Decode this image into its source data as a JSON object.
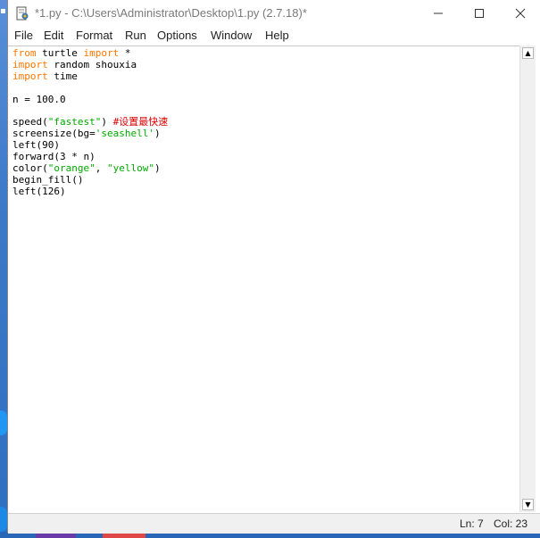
{
  "window": {
    "title": "*1.py - C:\\Users\\Administrator\\Desktop\\1.py (2.7.18)*"
  },
  "menu": [
    "File",
    "Edit",
    "Format",
    "Run",
    "Options",
    "Window",
    "Help"
  ],
  "editor": {
    "lines": [
      [
        {
          "t": "from",
          "c": "kw"
        },
        {
          "t": " turtle "
        },
        {
          "t": "import",
          "c": "kw"
        },
        {
          "t": " *"
        }
      ],
      [
        {
          "t": "import",
          "c": "kw"
        },
        {
          "t": " random shouxia"
        }
      ],
      [
        {
          "t": "import",
          "c": "kw"
        },
        {
          "t": " time"
        }
      ],
      [],
      [
        {
          "t": "n = 100.0"
        }
      ],
      [],
      [
        {
          "t": "speed("
        },
        {
          "t": "\"fastest\"",
          "c": "str"
        },
        {
          "t": ") "
        },
        {
          "t": "#设置最快速",
          "c": "cm"
        }
      ],
      [
        {
          "t": "screensize(bg="
        },
        {
          "t": "'seashell'",
          "c": "str"
        },
        {
          "t": ")"
        }
      ],
      [
        {
          "t": "left(90)"
        }
      ],
      [
        {
          "t": "forward(3 * n)"
        }
      ],
      [
        {
          "t": "color("
        },
        {
          "t": "\"orange\"",
          "c": "str"
        },
        {
          "t": ", "
        },
        {
          "t": "\"yellow\"",
          "c": "str"
        },
        {
          "t": ")"
        }
      ],
      [
        {
          "t": "begin_fill()"
        }
      ],
      [
        {
          "t": "left(126)"
        }
      ]
    ]
  },
  "status": {
    "line": "Ln: 7",
    "col": "Col: 23"
  },
  "colors": {
    "keyword": "#ff7700",
    "string": "#00aa00",
    "comment": "#dd0000"
  }
}
